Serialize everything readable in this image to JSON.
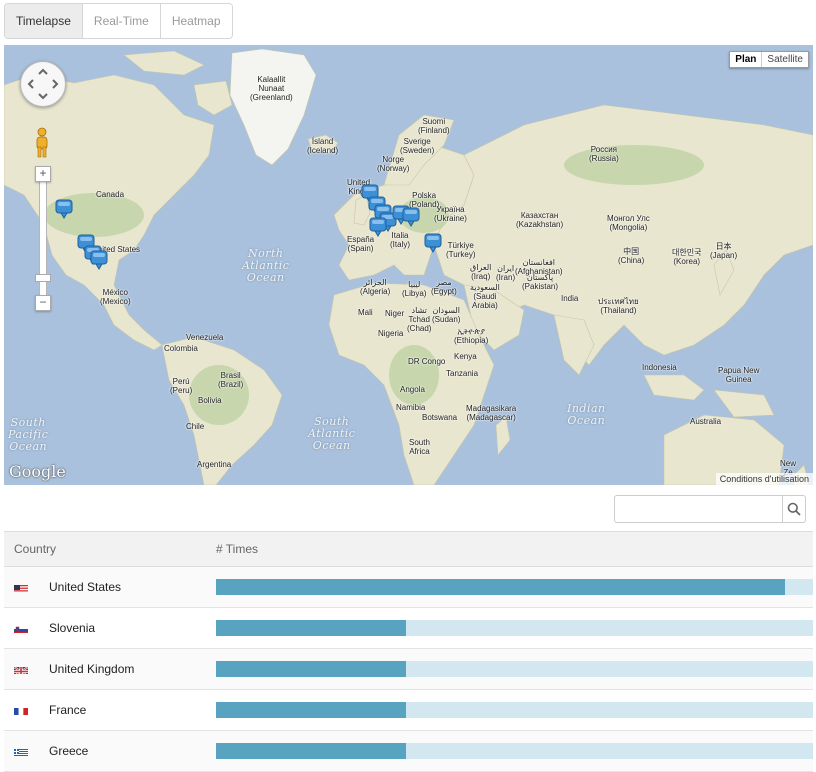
{
  "tabs": [
    {
      "label": "Timelapse",
      "active": true
    },
    {
      "label": "Real-Time",
      "active": false
    },
    {
      "label": "Heatmap",
      "active": false
    }
  ],
  "map": {
    "type_buttons": {
      "plan": "Plan",
      "satellite": "Satellite"
    },
    "zoom_in": "+",
    "zoom_out": "−",
    "logo": "Google",
    "terms": "Conditions d'utilisation",
    "oceans": {
      "north_atlantic": "North\nAtlantic\nOcean",
      "south_pacific": "South\nPacific\nOcean",
      "south_atlantic": "South\nAtlantic\nOcean",
      "indian": "Indian\nOcean"
    },
    "labels": {
      "greenland": "Kalaallit\nNunaat\n(Greenland)",
      "iceland": "Ísland\n(Iceland)",
      "finland": "Suomi\n(Finland)",
      "sweden": "Sverige\n(Sweden)",
      "norway": "Norge\n(Norway)",
      "russia": "Россия\n(Russia)",
      "uk": "United\nKingd",
      "poland": "Polska\n(Poland)",
      "ukraine": "Україна\n(Ukraine)",
      "kazakhstan": "Казахстан\n(Kazakhstan)",
      "mongolia": "Монгол Улс\n(Mongolia)",
      "canada": "Canada",
      "us": "United States",
      "mexico": "México\n(Mexico)",
      "spain": "España\n(Spain)",
      "italy": "Italia\n(Italy)",
      "turkey": "Türkiye\n(Turkey)",
      "china": "中国\n(China)",
      "korea": "대한민국\n(Korea)",
      "japan": "日本\n(Japan)",
      "algeria": "الجزائر\n(Algeria)",
      "libya": "ليبيا\n(Libya)",
      "egypt": "مصر\n(Egypt)",
      "iraq": "العراق\n(Iraq)",
      "iran": "ایران\n(Iran)",
      "afghanistan": "افغانستان\n(Afghanistan)",
      "pakistan": "پاکستان\n(Pakistan)",
      "saudi": "السعودية\n(Saudi\nArabia)",
      "india": "India",
      "thailand": "ประเทศไทย\n(Thailand)",
      "mali": "Mali",
      "niger": "Niger",
      "chad": "تشاد\nTchad\n(Chad)",
      "sudan": "السودان\n(Sudan)",
      "nigeria": "Nigeria",
      "ethiopia": "ኢትዮጵያ\n(Ethiopia)",
      "drc": "DR Congo",
      "kenya": "Kenya",
      "tanzania": "Tanzania",
      "angola": "Angola",
      "namibia": "Namibia",
      "botswana": "Botswana",
      "madagascar": "Madagasikara\n(Madagascar)",
      "south_africa": "South\nAfrica",
      "indonesia": "Indonesia",
      "png": "Papua New\nGuinea",
      "australia": "Australia",
      "new_zealand": "New\nZe",
      "venezuela": "Venezuela",
      "colombia": "Colombia",
      "peru": "Perú\n(Peru)",
      "brasil": "Brasil\n(Brazil)",
      "bolivia": "Bolivia",
      "chile": "Chile",
      "argentina": "Argentina"
    }
  },
  "search": {
    "value": "",
    "placeholder": ""
  },
  "table": {
    "headers": {
      "country": "Country",
      "times": "# Times"
    },
    "max_times": 3,
    "rows": [
      {
        "country": "United States",
        "times": 3,
        "flag": "us"
      },
      {
        "country": "Slovenia",
        "times": 1,
        "flag": "si"
      },
      {
        "country": "United Kingdom",
        "times": 1,
        "flag": "gb"
      },
      {
        "country": "France",
        "times": 1,
        "flag": "fr"
      },
      {
        "country": "Greece",
        "times": 1,
        "flag": "gr"
      }
    ]
  },
  "colors": {
    "bar_fill": "#58a3bf",
    "bar_track": "#d3e7f0",
    "marker": "#3d8fd6",
    "water": "#a9c1dc",
    "land": "#e8e6cf"
  }
}
